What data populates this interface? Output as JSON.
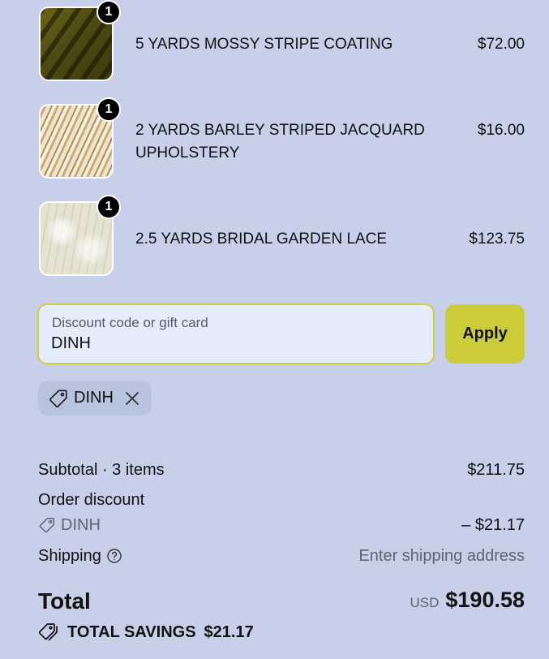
{
  "line_items": [
    {
      "quantity": "1",
      "name": "5 YARDS MOSSY STRIPE COATING",
      "price": "$72.00"
    },
    {
      "quantity": "1",
      "name": "2 YARDS BARLEY STRIPED JACQUARD UPHOLSTERY",
      "price": "$16.00"
    },
    {
      "quantity": "1",
      "name": "2.5 YARDS BRIDAL GARDEN LACE",
      "price": "$123.75"
    }
  ],
  "discount": {
    "placeholder": "Discount code or gift card",
    "value": "DINH",
    "apply_label": "Apply",
    "applied_code": "DINH"
  },
  "summary": {
    "subtotal_label": "Subtotal · 3 items",
    "subtotal_value": "$211.75",
    "order_discount_label": "Order discount",
    "order_discount_code": "DINH",
    "order_discount_value": "– $21.17",
    "shipping_label": "Shipping",
    "shipping_value": "Enter shipping address",
    "total_label": "Total",
    "currency": "USD",
    "total_value": "$190.58",
    "savings_label": "TOTAL SAVINGS",
    "savings_value": "$21.17"
  },
  "colors": {
    "page_background": "#c7d0e8",
    "accent": "#cccc38",
    "badge": "#000000",
    "muted_text": "#5e6471"
  },
  "icons": {
    "tag": "tag-icon",
    "close": "close-icon",
    "help": "help-circle-icon",
    "savings": "tags-icon"
  }
}
